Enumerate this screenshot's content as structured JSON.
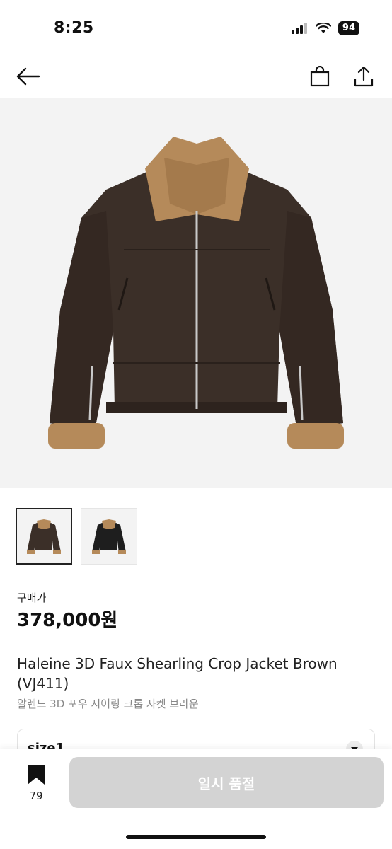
{
  "status_bar": {
    "time": "8:25",
    "battery": "94"
  },
  "nav": {
    "back_icon": "arrow-left-icon",
    "cart_icon": "shopping-bag-icon",
    "share_icon": "share-icon"
  },
  "product": {
    "price_label": "구매가",
    "price": "378,000원",
    "name_en": "Haleine 3D Faux Shearling Crop Jacket Brown (VJ411)",
    "name_ko": "알렌느 3D 포우 시어링 크롭 자켓 브라운",
    "thumbnails": [
      "brown jacket",
      "black jacket"
    ]
  },
  "size_select": {
    "value": "size1"
  },
  "bottom_bar": {
    "bookmark_count": "79",
    "buy_label": "일시 품절"
  },
  "colors": {
    "jacket_brown": "#3b2f28",
    "shearling": "#b58a5a",
    "disabled_button": "#d3d3d3"
  }
}
